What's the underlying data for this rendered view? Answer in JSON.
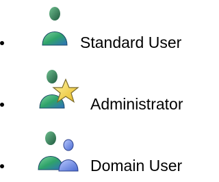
{
  "list": {
    "items": [
      {
        "label": "Standard User",
        "icon": "user-icon"
      },
      {
        "label": "Administrator",
        "icon": "admin-user-icon"
      },
      {
        "label": "Domain User",
        "icon": "domain-user-icon"
      }
    ]
  },
  "colors": {
    "head": "#2e7a5a",
    "body_green": "#2fa36a",
    "body_blue": "#2f6fbf",
    "star": "#f4d233",
    "domain_user": "#6a8ce0"
  }
}
